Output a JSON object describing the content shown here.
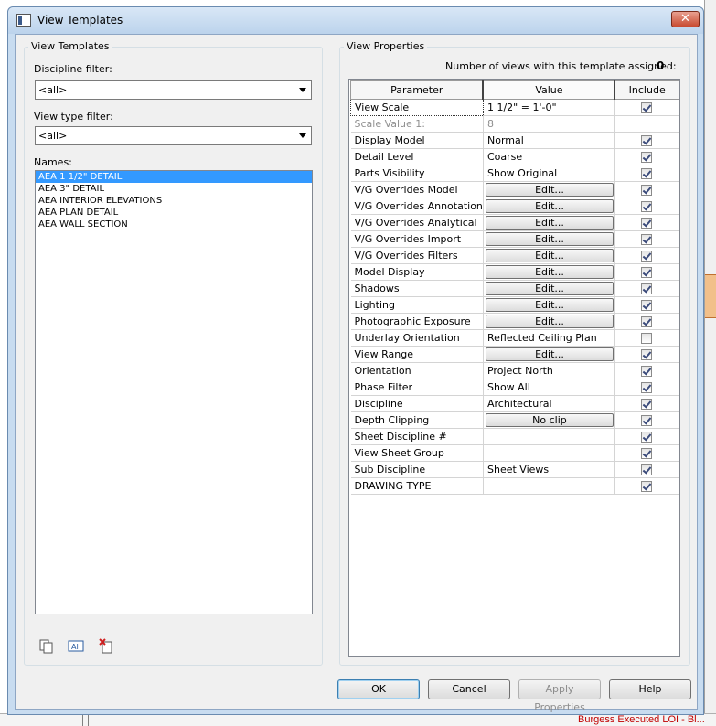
{
  "window": {
    "title": "View Templates",
    "close_glyph": "✕"
  },
  "left_group": {
    "title": "View Templates",
    "discipline_filter": {
      "label": "Discipline filter:",
      "value": "<all>"
    },
    "view_type_filter": {
      "label": "View type filter:",
      "value": "<all>"
    },
    "names_label": "Names:",
    "names": [
      "AEA 1 1/2\" DETAIL",
      "AEA 3\" DETAIL",
      "AEA INTERIOR ELEVATIONS",
      "AEA PLAN DETAIL",
      "AEA WALL SECTION"
    ],
    "selected_index": 0,
    "toolbar_icons": [
      "duplicate-icon",
      "rename-icon",
      "delete-icon"
    ]
  },
  "right_group": {
    "title": "View Properties",
    "assigned_label": "Number of views with this template assigned:",
    "assigned_count": "0",
    "columns": {
      "parameter": "Parameter",
      "value": "Value",
      "include": "Include"
    },
    "rows": [
      {
        "param": "View Scale",
        "value": "1 1/2\" = 1'-0\"",
        "type": "text",
        "include": true
      },
      {
        "param": "Scale Value   1:",
        "value": "8",
        "type": "text",
        "include": null,
        "disabled": true
      },
      {
        "param": "Display Model",
        "value": "Normal",
        "type": "text",
        "include": true
      },
      {
        "param": "Detail Level",
        "value": "Coarse",
        "type": "text",
        "include": true
      },
      {
        "param": "Parts Visibility",
        "value": "Show Original",
        "type": "text",
        "include": true
      },
      {
        "param": "V/G Overrides Model",
        "value": "Edit...",
        "type": "button",
        "include": true
      },
      {
        "param": "V/G Overrides Annotation",
        "value": "Edit...",
        "type": "button",
        "include": true
      },
      {
        "param": "V/G Overrides Analytical",
        "value": "Edit...",
        "type": "button",
        "include": true
      },
      {
        "param": "V/G Overrides Import",
        "value": "Edit...",
        "type": "button",
        "include": true
      },
      {
        "param": "V/G Overrides Filters",
        "value": "Edit...",
        "type": "button",
        "include": true
      },
      {
        "param": "Model Display",
        "value": "Edit...",
        "type": "button",
        "include": true
      },
      {
        "param": "Shadows",
        "value": "Edit...",
        "type": "button",
        "include": true
      },
      {
        "param": "Lighting",
        "value": "Edit...",
        "type": "button",
        "include": true
      },
      {
        "param": "Photographic Exposure",
        "value": "Edit...",
        "type": "button",
        "include": true
      },
      {
        "param": "Underlay Orientation",
        "value": "Reflected Ceiling Plan",
        "type": "text",
        "include": false
      },
      {
        "param": "View Range",
        "value": "Edit...",
        "type": "button",
        "include": true
      },
      {
        "param": "Orientation",
        "value": "Project North",
        "type": "text",
        "include": true
      },
      {
        "param": "Phase Filter",
        "value": "Show All",
        "type": "text",
        "include": true
      },
      {
        "param": "Discipline",
        "value": "Architectural",
        "type": "text",
        "include": true
      },
      {
        "param": "Depth Clipping",
        "value": "No clip",
        "type": "button",
        "include": true
      },
      {
        "param": "Sheet Discipline #",
        "value": "",
        "type": "text",
        "include": true
      },
      {
        "param": "View Sheet Group",
        "value": "",
        "type": "text",
        "include": true
      },
      {
        "param": "Sub Discipline",
        "value": "Sheet Views",
        "type": "text",
        "include": true
      },
      {
        "param": "DRAWING TYPE",
        "value": "",
        "type": "text",
        "include": true
      }
    ]
  },
  "buttons": {
    "ok": "OK",
    "cancel": "Cancel",
    "apply": "Apply Properties",
    "help": "Help"
  },
  "background": {
    "taskbar_text": "Burgess Executed LOI - Bl..."
  }
}
